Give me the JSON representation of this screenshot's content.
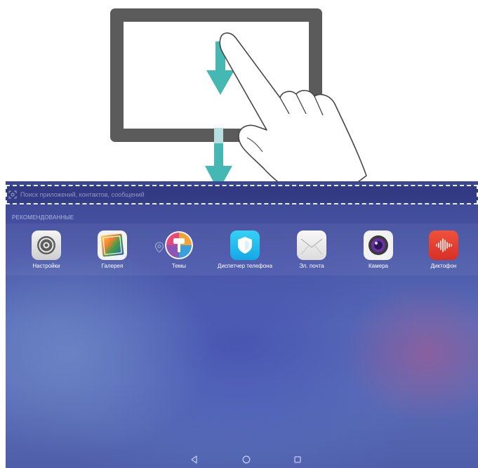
{
  "search": {
    "placeholder": "Поиск приложений, контактов, сообщений"
  },
  "recommended": {
    "title": "РЕКОМЕНДОВАННЫЕ",
    "apps": [
      {
        "label": "Настройки",
        "icon": "settings-gear-icon"
      },
      {
        "label": "Галерея",
        "icon": "gallery-icon"
      },
      {
        "label": "Темы",
        "icon": "themes-icon"
      },
      {
        "label": "Диспетчер телефона",
        "icon": "phone-manager-shield-icon"
      },
      {
        "label": "Эл. почта",
        "icon": "email-envelope-icon"
      },
      {
        "label": "Камера",
        "icon": "camera-icon"
      },
      {
        "label": "Диктофон",
        "icon": "recorder-icon"
      }
    ]
  },
  "navigation": {
    "buttons": [
      "back-icon",
      "home-icon",
      "recents-icon"
    ]
  },
  "colors": {
    "tablet_frame": "#5b5b5b",
    "arrow": "#45b8b4",
    "screen_top": "#3c4592",
    "screen_bottom": "#4f5ea9",
    "dashed_highlight": "#e6f2fb"
  }
}
